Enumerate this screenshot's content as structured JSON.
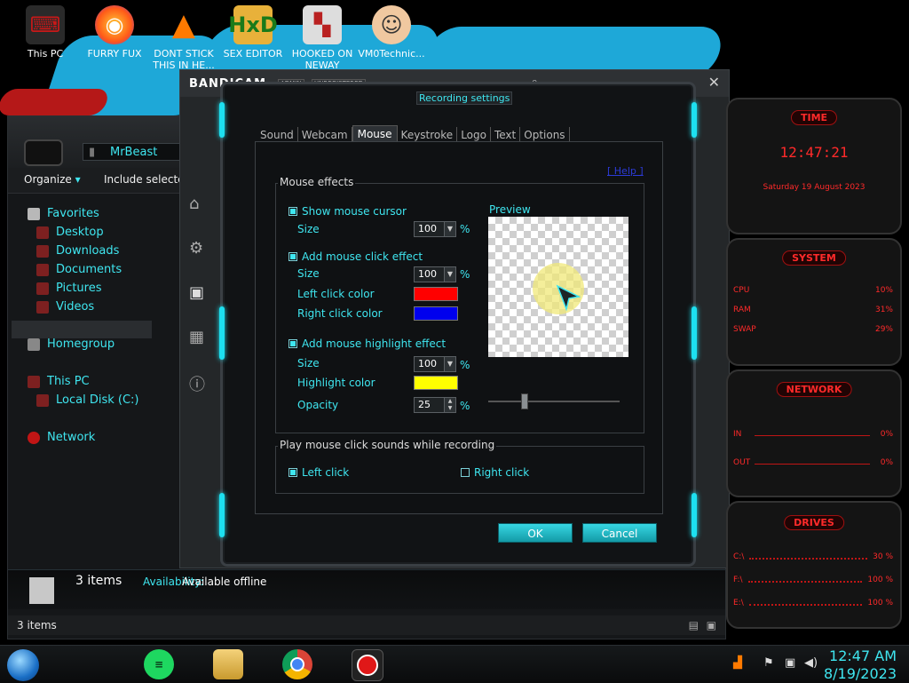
{
  "desktop": {
    "icons": [
      {
        "label": "This PC",
        "icon": "computer-icon",
        "color": "#c91818"
      },
      {
        "label": "FURRY FUX",
        "icon": "firefox-icon",
        "color": "#ff7a18"
      },
      {
        "label": "DONT STICK THIS IN HE...",
        "icon": "vlc-icon",
        "color": "#ff7a00"
      },
      {
        "label": "SEX EDITOR",
        "icon": "hxd-icon",
        "color": "#e8b13a"
      },
      {
        "label": "HOOKED ON NEWAY",
        "icon": "game-icon",
        "color": "#b92020"
      },
      {
        "label": "VM0Technic...",
        "icon": "doctor-icon",
        "color": "#f0c8a0"
      }
    ]
  },
  "explorer": {
    "address": "MrBeast",
    "toolbar": {
      "organize": "Organize",
      "include": "Include selected"
    },
    "nav": [
      {
        "label": "Favorites",
        "icon": "star-icon"
      },
      {
        "label": "Desktop",
        "icon": "desktop-icon"
      },
      {
        "label": "Downloads",
        "icon": "downloads-icon"
      },
      {
        "label": "Documents",
        "icon": "documents-icon"
      },
      {
        "label": "Pictures",
        "icon": "pictures-icon"
      },
      {
        "label": "Videos",
        "icon": "videos-icon"
      },
      {
        "label": "Homegroup",
        "icon": "homegroup-icon"
      },
      {
        "label": "This PC",
        "icon": "computer-icon"
      },
      {
        "label": "Local Disk (C:)",
        "icon": "disk-icon"
      },
      {
        "label": "Network",
        "icon": "network-icon"
      }
    ],
    "details": {
      "count": "3 items",
      "availability_label": "Availability:",
      "availability_value": "Available offline"
    },
    "status": "3 items"
  },
  "bandicam": {
    "title": "BANDICAM",
    "badges": [
      "ADMIN",
      "UNREGISTERED"
    ],
    "close": "✕"
  },
  "dialog": {
    "title": "Recording settings",
    "tabs": [
      "Sound",
      "Webcam",
      "Mouse",
      "Keystroke",
      "Logo",
      "Text",
      "Options"
    ],
    "active_tab": "Mouse",
    "help": "[ Help ]",
    "mouse_effects": {
      "group_label": "Mouse effects",
      "show_cursor": {
        "label": "Show mouse cursor",
        "checked": true
      },
      "cursor_size": {
        "label": "Size",
        "value": "100",
        "unit": "%"
      },
      "click_effect": {
        "label": "Add mouse click effect",
        "checked": true
      },
      "click_size": {
        "label": "Size",
        "value": "100",
        "unit": "%"
      },
      "left_color": {
        "label": "Left click color",
        "color": "#ff0000"
      },
      "right_color": {
        "label": "Right click color",
        "color": "#0000ee"
      },
      "highlight": {
        "label": "Add mouse highlight effect",
        "checked": true
      },
      "highlight_size": {
        "label": "Size",
        "value": "100",
        "unit": "%"
      },
      "highlight_color": {
        "label": "Highlight color",
        "color": "#ffff00"
      },
      "opacity": {
        "label": "Opacity",
        "value": "25",
        "unit": "%"
      },
      "preview_label": "Preview",
      "opacity_slider": 0.25
    },
    "click_sounds": {
      "group_label": "Play mouse click sounds while recording",
      "left": {
        "label": "Left click",
        "checked": true
      },
      "right": {
        "label": "Right click",
        "checked": false
      }
    },
    "ok": "OK",
    "cancel": "Cancel"
  },
  "widgets": {
    "time": {
      "title": "TIME",
      "clock": "12:47:21",
      "date": "Saturday 19 August 2023"
    },
    "system": {
      "title": "SYSTEM",
      "rows": [
        {
          "name": "CPU",
          "value": "10%"
        },
        {
          "name": "RAM",
          "value": "31%"
        },
        {
          "name": "SWAP",
          "value": "29%"
        }
      ]
    },
    "network": {
      "title": "NETWORK",
      "rows": [
        {
          "name": "IN",
          "value": "0%"
        },
        {
          "name": "OUT",
          "value": "0%"
        }
      ]
    },
    "drives": {
      "title": "DRIVES",
      "rows": [
        {
          "name": "C:\\",
          "value": "30 %"
        },
        {
          "name": "F:\\",
          "value": "100 %"
        },
        {
          "name": "E:\\",
          "value": "100 %"
        }
      ]
    }
  },
  "taskbar": {
    "apps": [
      "spotify-icon",
      "file-explorer-icon",
      "chrome-icon",
      "bandicam-record-icon"
    ],
    "time": "12:47 AM",
    "date": "8/19/2023"
  }
}
